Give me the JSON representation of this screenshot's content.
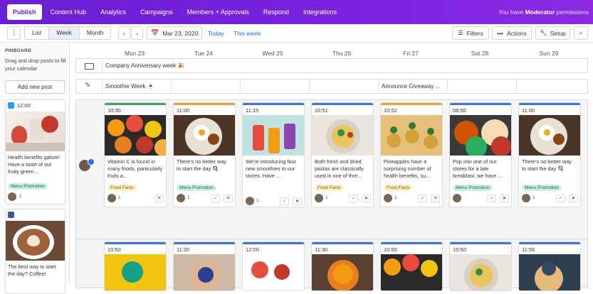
{
  "nav": {
    "tabs": [
      "Publish",
      "Content Hub",
      "Analytics",
      "Campaigns",
      "Members + Approvals",
      "Respond",
      "Integrations"
    ],
    "permission_prefix": "You have",
    "permission_role": "Moderator",
    "permission_suffix": "permissions"
  },
  "toolbar": {
    "views": [
      "List",
      "Week",
      "Month"
    ],
    "active_view": "Week",
    "date": "Mar 23, 2020",
    "today": "Today",
    "this_week": "This week",
    "filters": "Filters",
    "actions": "Actions",
    "setup": "Setup"
  },
  "sidebar": {
    "title": "PINBOARD",
    "hint": "Drag and drop posts to fill your calendar",
    "add_button": "Add new post",
    "cards": [
      {
        "network": "twitter",
        "time": "12:00",
        "text": "Health benefits galore! Have a taste of our fruity green...",
        "tag": "Menu Promotion",
        "images": "1"
      },
      {
        "network": "facebook",
        "time": "",
        "text": "The best way to start the day? Coffee!",
        "tag": "",
        "images": ""
      }
    ]
  },
  "days": [
    "Mon 23",
    "Tue 24",
    "Wed 25",
    "Thu 26",
    "Fri 27",
    "Sat 28",
    "Sun 29"
  ],
  "header_rows": [
    {
      "icon": "calendar-event-icon",
      "cells": [
        {
          "text": "Company Anniversary week 🎉",
          "start": 0,
          "span": 7
        }
      ]
    },
    {
      "icon": "pencil-icon",
      "cells": [
        {
          "text": "Smoothie Week 🍷",
          "start": 0,
          "span": 1
        },
        {
          "text": "Announce Giveaway ...",
          "start": 4,
          "span": 1
        }
      ]
    }
  ],
  "row1": [
    {
      "time": "10:30",
      "text": "Vitamin C is found in many foods, particularly fruits a...",
      "tag": "Food Facts",
      "tagc": "y",
      "imgs": "1",
      "icons": [
        "x"
      ],
      "bar": "g"
    },
    {
      "time": "11:00",
      "text": "There's no better way to start the day 🍳",
      "tag": "Menu Promotion",
      "tagc": "g",
      "imgs": "1",
      "icons": [
        "c",
        "x"
      ],
      "bar": "o"
    },
    {
      "time": "11:15",
      "text": "We're introducing four new smoothies to our stores. Have ...",
      "tag": "",
      "tagc": "",
      "imgs": "1",
      "icons": [
        "c",
        "s"
      ],
      "bar": "b"
    },
    {
      "time": "10:51",
      "text": "Both fresh and dried pastas are classically used in one of thre...",
      "tag": "Food Facts",
      "tagc": "y",
      "imgs": "1",
      "icons": [
        "c",
        "s"
      ],
      "bar": "b"
    },
    {
      "time": "10:52",
      "text": "Pineapples have a surprising number of health benefits, su...",
      "tag": "Food Facts",
      "tagc": "y",
      "imgs": "1",
      "icons": [
        "c",
        "x"
      ],
      "bar": "o"
    },
    {
      "time": "08:50",
      "text": "Pop into one of our stores for a late breakfast, we have ...",
      "tag": "Menu Promotion",
      "tagc": "g",
      "imgs": "",
      "icons": [
        "c",
        "s"
      ],
      "bar": "b"
    },
    {
      "time": "11:00",
      "text": "There's no better way to start the day 🍳",
      "tag": "Menu Promotion",
      "tagc": "g",
      "imgs": "1",
      "icons": [
        "c",
        "s"
      ],
      "bar": "b"
    }
  ],
  "row2": [
    {
      "time": "10:50"
    },
    {
      "time": "11:20"
    },
    {
      "time": "12:00"
    },
    {
      "time": "11:30"
    },
    {
      "time": "10:50"
    },
    {
      "time": "10:50"
    },
    {
      "time": "11:56"
    }
  ],
  "colors": {
    "nav": "#6a1fd1",
    "accent": "#1e6fd9",
    "green_tag": "#cdeee6",
    "yellow_tag": "#fdf0c4"
  }
}
